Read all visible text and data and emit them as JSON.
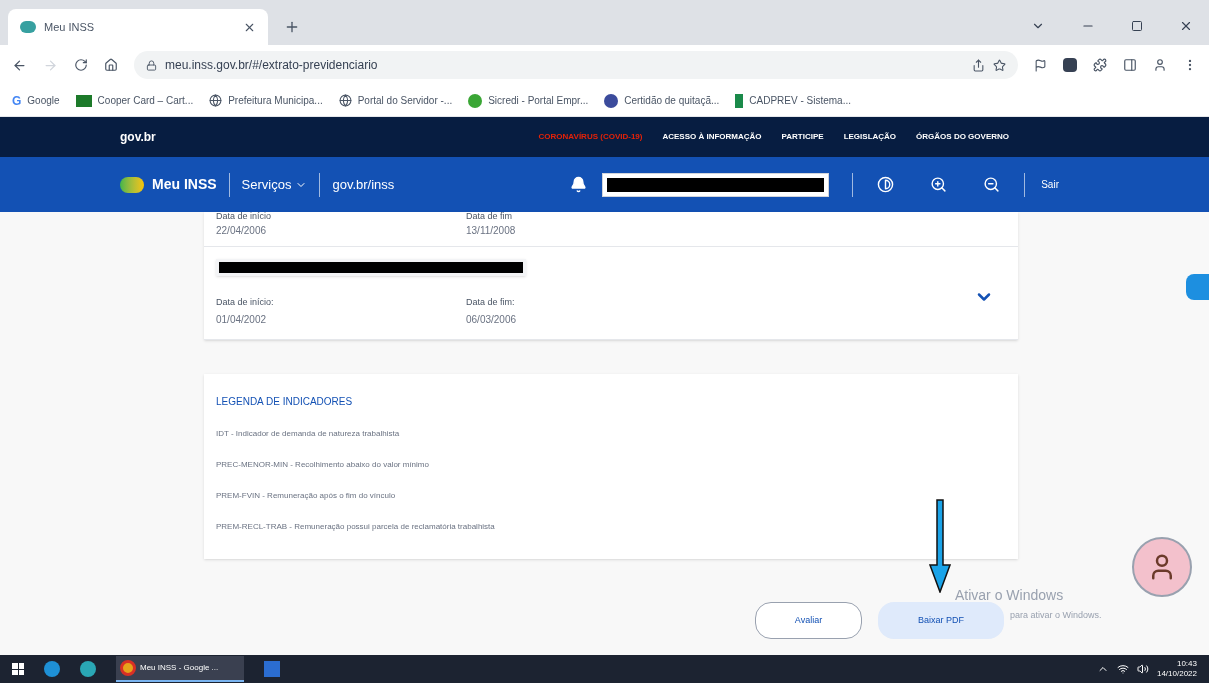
{
  "browser": {
    "tab": {
      "title": "Meu INSS"
    },
    "url": "meu.inss.gov.br/#/extrato-previdenciario",
    "bookmarks": [
      {
        "label": "Google",
        "kind": "google",
        "glyph": "G"
      },
      {
        "label": "Cooper Card – Cart...",
        "kind": "card"
      },
      {
        "label": "Prefeitura Municipa...",
        "kind": "globe"
      },
      {
        "label": "Portal do Servidor -...",
        "kind": "globe"
      },
      {
        "label": "Sicredi - Portal Empr...",
        "kind": "leaf"
      },
      {
        "label": "Certidão de quitaçã...",
        "kind": "seal"
      },
      {
        "label": "CADPREV - Sistema...",
        "kind": "pin"
      }
    ]
  },
  "gov_bar": {
    "logo": "gov.br",
    "links": [
      {
        "label": "CORONAVÍRUS (COVID-19)",
        "alert": true
      },
      {
        "label": "ACESSO À INFORMAÇÃO",
        "alert": false
      },
      {
        "label": "PARTICIPE",
        "alert": false
      },
      {
        "label": "LEGISLAÇÃO",
        "alert": false
      },
      {
        "label": "ÓRGÃOS DO GOVERNO",
        "alert": false
      }
    ]
  },
  "app_bar": {
    "title": "Meu INSS",
    "menu": "Serviços",
    "link": "gov.br/inss",
    "logout": "Sair"
  },
  "records": [
    {
      "start_label": "Data de início",
      "start": "22/04/2006",
      "end_label": "Data de fim",
      "end": "13/11/2008",
      "redacted": false
    },
    {
      "start_label": "Data de início:",
      "start": "01/04/2002",
      "end_label": "Data de fim:",
      "end": "06/03/2006",
      "redacted": true
    }
  ],
  "legend": {
    "title": "LEGENDA DE INDICADORES",
    "items": [
      "IDT - Indicador de demanda de natureza trabalhista",
      "PREC-MENOR-MIN - Recolhimento abaixo do valor mínimo",
      "PREM-FVIN - Remuneração após o fim do vínculo",
      "PREM-RECL-TRAB - Remuneração possui parcela de reclamatória trabalhista"
    ]
  },
  "actions": [
    {
      "label": "Avaliar",
      "kind": "outline"
    },
    {
      "label": "Baixar PDF",
      "kind": "filled"
    }
  ],
  "activation": {
    "title": "Ativar o Windows",
    "text": "para ativar o Windows."
  },
  "taskbar": {
    "window": "Meu INSS - Google ...",
    "time": "10:43",
    "date": "14/10/2022"
  }
}
